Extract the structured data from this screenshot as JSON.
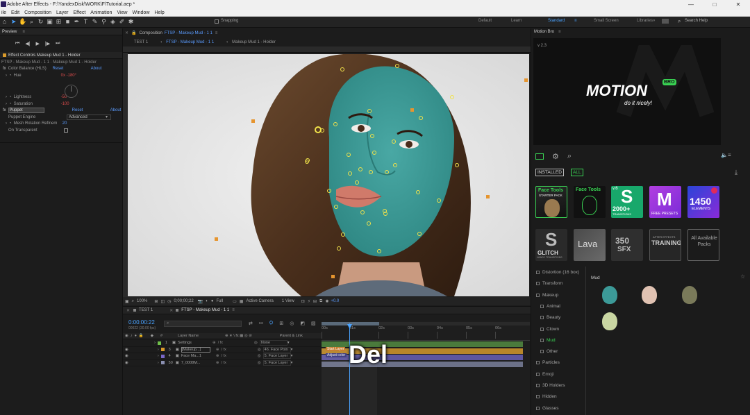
{
  "window": {
    "title": "Adobe After Effects - F:\\YandexDisk\\WORK\\F\\Tutorial.aep *",
    "minimize": "—",
    "maximize": "□",
    "close": "✕"
  },
  "menu": [
    "ile",
    "Edit",
    "Composition",
    "Layer",
    "Effect",
    "Animation",
    "View",
    "Window",
    "Help"
  ],
  "toolbar": {
    "snapping": "Snapping",
    "workspaces": [
      "Default",
      "Learn",
      "Standard",
      "Small Screen",
      "Libraries"
    ],
    "active_workspace": "Standard",
    "search_help": "Search Help"
  },
  "preview": {
    "title": "Preview"
  },
  "effect_controls": {
    "title": "Effect Controls Makeup Mud 1 - Holder",
    "breadcrumb": "FTSP - Makeup Mud - 1 1 · Makeup Mud 1 - Holder",
    "color_balance": {
      "name": "Color Balance (HLS)",
      "reset": "Reset",
      "about": "About"
    },
    "hue": {
      "label": "Hue",
      "value": "0x -180°"
    },
    "lightness": {
      "label": "Lightness",
      "value": "-50"
    },
    "saturation": {
      "label": "Saturation",
      "value": "-100"
    },
    "puppet": {
      "name": "Puppet",
      "reset": "Reset",
      "about": "About"
    },
    "puppet_engine": {
      "label": "Puppet Engine",
      "value": "Advanced"
    },
    "mesh_rotation": {
      "label": "Mesh Rotation Refinem",
      "value": "20"
    },
    "on_transparent": {
      "label": "On Transparent"
    }
  },
  "composition": {
    "title": "Composition",
    "name": "FTSP - Makeup Mud - 1 1",
    "tabs": [
      "TEST 1",
      "FTSP - Makeup Mud - 1 1",
      "Makeup Mud 1 - Holder"
    ],
    "zoom": "100%",
    "timecode": "0;00;00;22",
    "resolution": "Full",
    "camera": "Active Camera",
    "view": "1 View",
    "exposure": "+0.0"
  },
  "timeline": {
    "tabs": [
      "TEST 1",
      "FTSP - Makeup Mud - 1 1"
    ],
    "timecode": "0:00:00:22",
    "frame": "00022 (30.00 fps)",
    "search_placeholder": "",
    "col_layer_name": "Layer Name",
    "col_parent": "Parent & Link",
    "time_labels": [
      "00s",
      "01s",
      "02s",
      "03s",
      "04s",
      "05s",
      "06s"
    ],
    "layers": [
      {
        "num": "1",
        "name": "Settings",
        "parent": "None",
        "color": "#6fbf4a"
      },
      {
        "num": "3",
        "name": "[Makeup...]",
        "parent": "46. Face Poin",
        "color": "#d99a2b"
      },
      {
        "num": "4",
        "name": "Face Ma...1",
        "parent": "5. Face Layer",
        "color": "#7a68c8"
      },
      {
        "num": "50",
        "name": "7_0008M...",
        "parent": "5. Face Layer",
        "color": "#8a8fb0"
      }
    ],
    "bar_labels": [
      "Start Layer",
      "Adjust color"
    ],
    "overlay_text": "Del"
  },
  "motion_bro": {
    "panel_title": "Motion Bro",
    "version": "v 2.3",
    "logo_text": "MOTION",
    "logo_badge": "BRO",
    "tagline": "do it nicely!",
    "filter_installed": "INSTALLED",
    "filter_all": "ALL",
    "packs_row1": [
      {
        "title": "Face Tools",
        "subtitle": "STARTER PACK"
      },
      {
        "title": "Face Tools",
        "subtitle": ""
      },
      {
        "title": "2000+",
        "subtitle": "TRANSITIONS",
        "badge": "v.6"
      },
      {
        "title": "M",
        "subtitle": "FREE PRESETS"
      },
      {
        "title": "1450",
        "subtitle": "ELEMENTS"
      }
    ],
    "packs_row2": [
      {
        "title": "GLITCH",
        "subtitle": "HANDY TRANSITIONS"
      },
      {
        "title": "Lava",
        "subtitle": ""
      },
      {
        "title": "350",
        "subtitle": "SFX"
      },
      {
        "title": "TRAINING",
        "subtitle": "AFTER EFFECTS"
      },
      {
        "title": "All Available Packs",
        "subtitle": ""
      }
    ],
    "categories": [
      "Distortion (16 box)",
      "Transform",
      "Makeup",
      "Animal",
      "Beauty",
      "Clown",
      "Mud",
      "Other",
      "Particles",
      "Emoji",
      "3D Holders",
      "Hidden",
      "Glasses"
    ],
    "active_category": "Mud",
    "preview_title": "Mud"
  },
  "colors": {
    "accent": "#4aa3ff",
    "pin": "#f0e24a",
    "handle": "#e6952f",
    "mud": "#3c9a98",
    "motion_green": "#39d353"
  }
}
